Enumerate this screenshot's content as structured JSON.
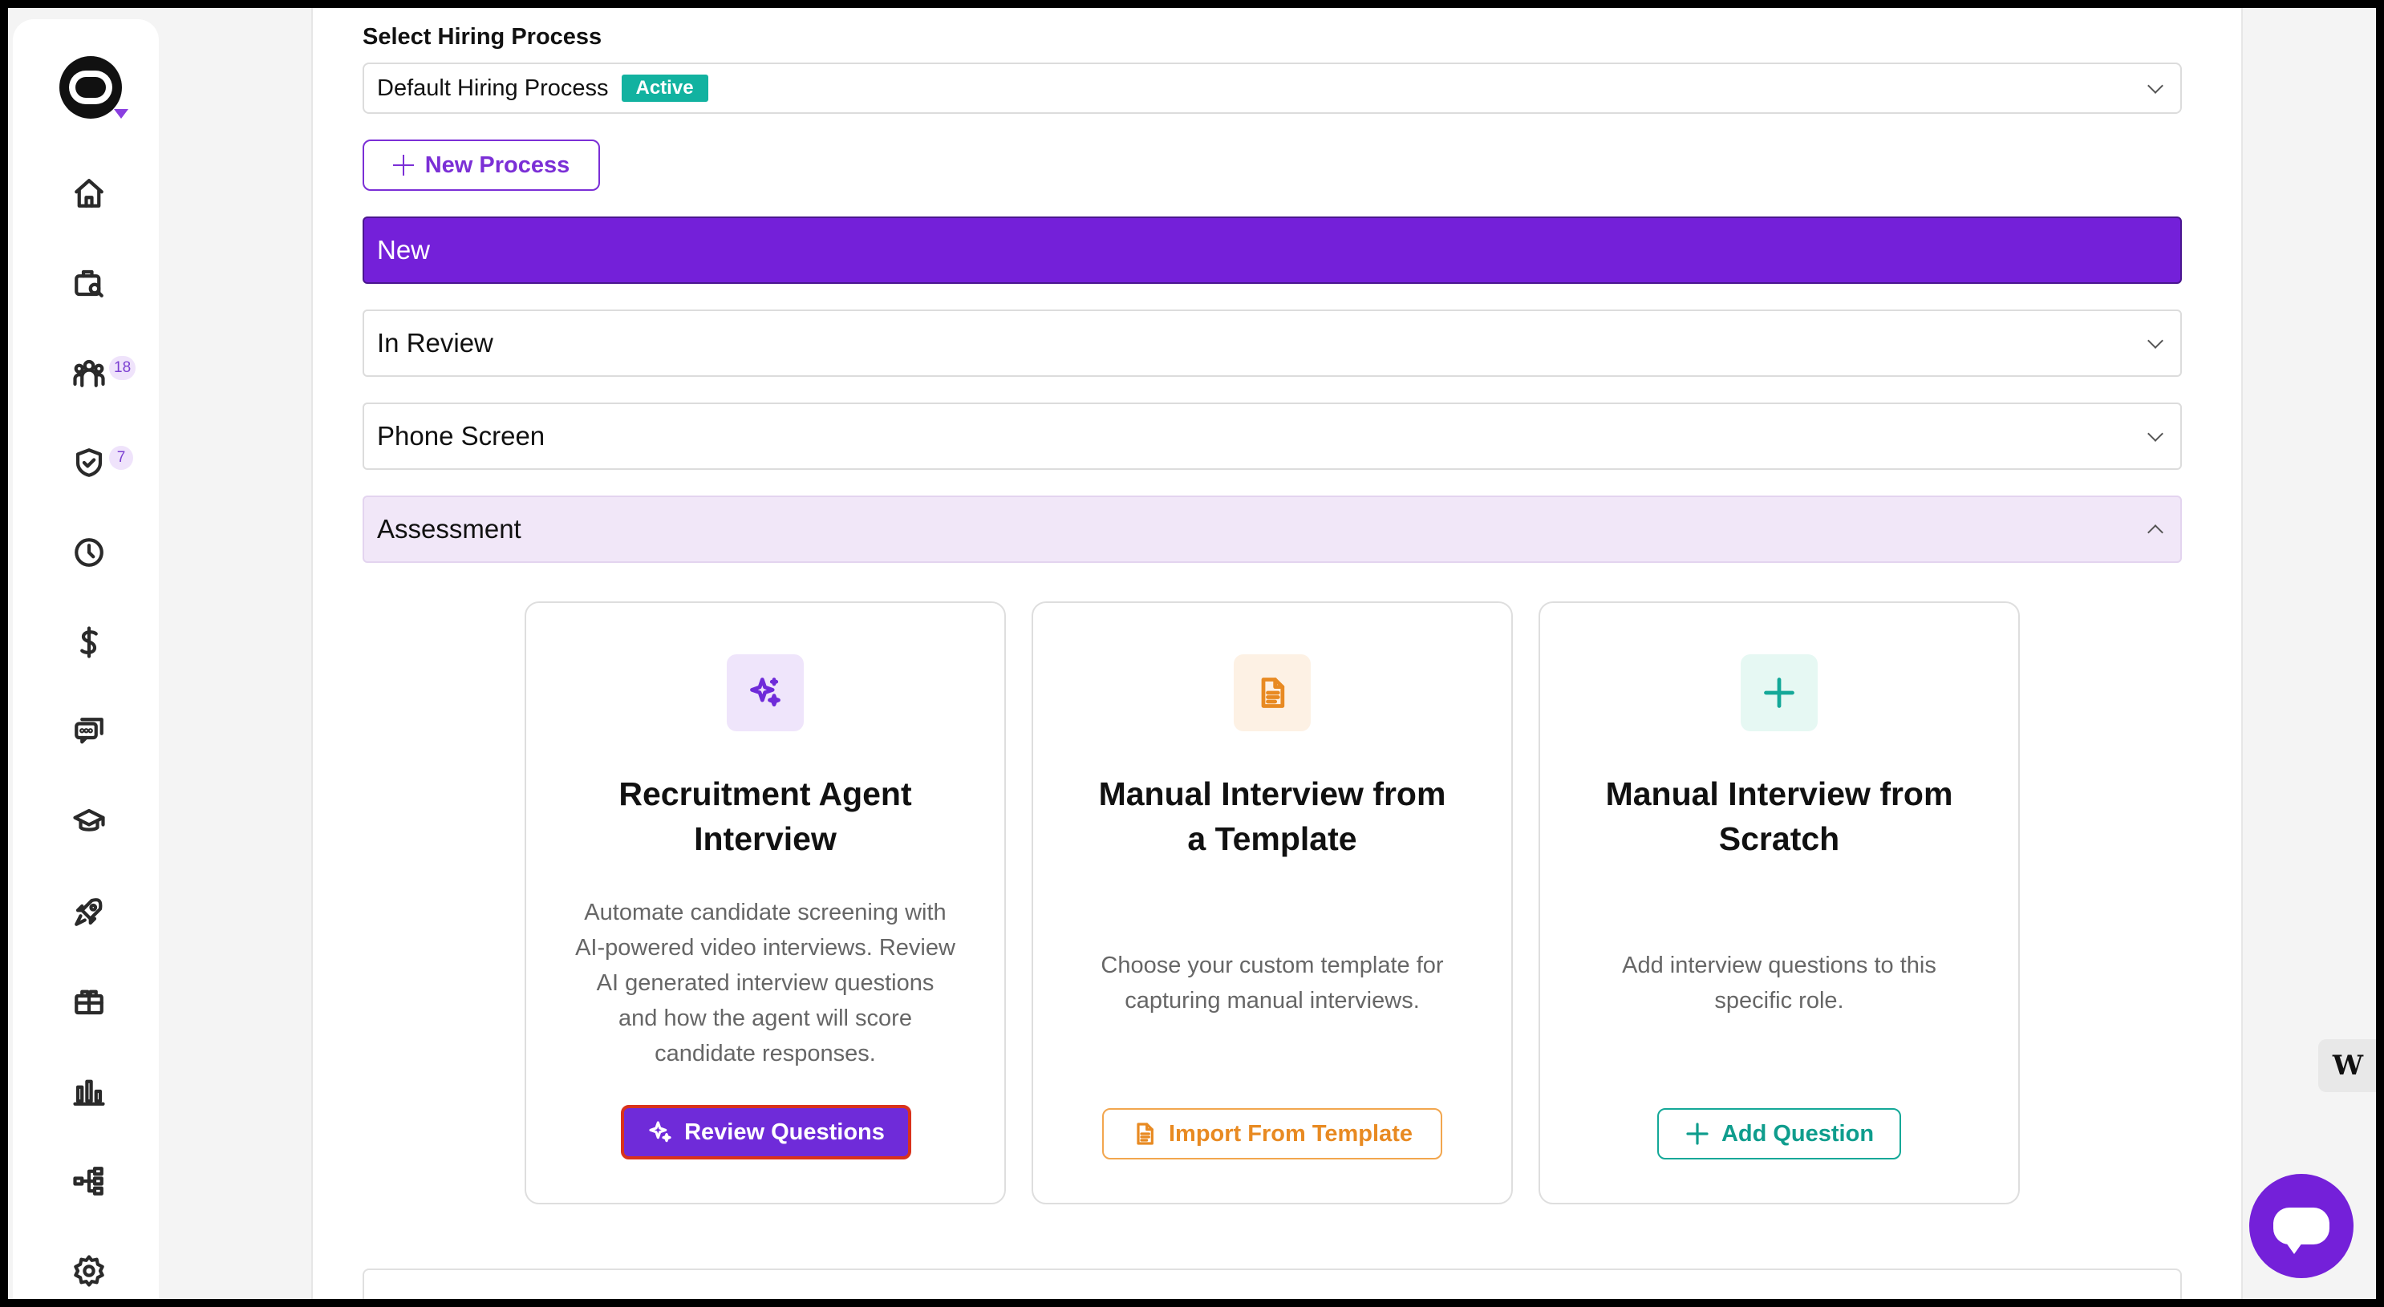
{
  "sidebar": {
    "badges": {
      "people": "18",
      "approvals": "7"
    },
    "items": [
      {
        "name": "home-icon"
      },
      {
        "name": "jobs-search-icon"
      },
      {
        "name": "candidates-icon"
      },
      {
        "name": "approvals-icon"
      },
      {
        "name": "clock-icon"
      },
      {
        "name": "dollar-icon"
      },
      {
        "name": "chat-icon"
      },
      {
        "name": "graduation-icon"
      },
      {
        "name": "rocket-icon"
      },
      {
        "name": "gift-icon"
      },
      {
        "name": "bar-chart-icon"
      },
      {
        "name": "org-chart-icon"
      },
      {
        "name": "settings-icon"
      }
    ]
  },
  "hiring": {
    "label": "Select Hiring Process",
    "selected_process": "Default Hiring Process",
    "status": "Active",
    "new_process_label": "New Process"
  },
  "stages": [
    {
      "label": "New"
    },
    {
      "label": "In Review"
    },
    {
      "label": "Phone Screen"
    },
    {
      "label": "Assessment"
    }
  ],
  "cards": [
    {
      "title": "Recruitment Agent Interview",
      "description": "Automate candidate screening with AI-powered video interviews. Review AI generated interview questions and how the agent will score candidate responses.",
      "button": "Review Questions"
    },
    {
      "title": "Manual Interview from a Template",
      "description": "Choose your custom template for capturing manual interviews.",
      "button": "Import From Template"
    },
    {
      "title": "Manual Interview from Scratch",
      "description": "Add interview questions to this specific role.",
      "button": "Add Question"
    }
  ],
  "widget": {
    "label": "W"
  },
  "colors": {
    "primary": "#7420d9",
    "active_badge": "#12b2a0",
    "template_orange": "#e88a22",
    "scratch_teal": "#0f9d8d"
  }
}
